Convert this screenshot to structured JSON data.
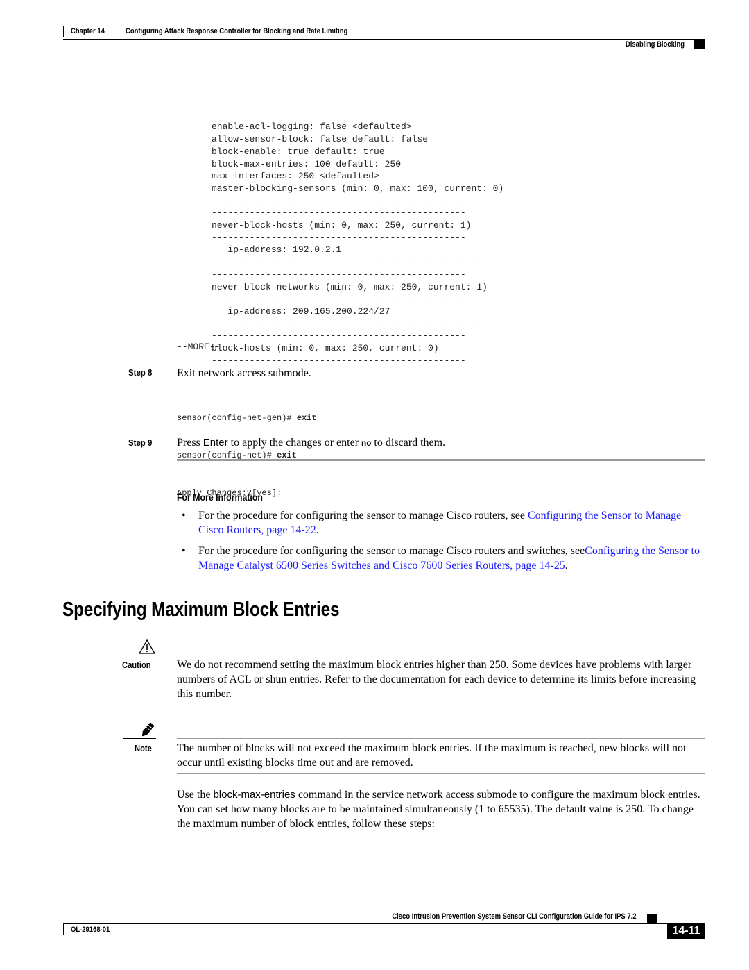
{
  "header": {
    "chapter_label": "Chapter 14",
    "chapter_title": "Configuring Attack Response Controller for Blocking and Rate Limiting",
    "section_title": "Disabling Blocking"
  },
  "code_block": {
    "lines": [
      "enable-acl-logging: false <defaulted>",
      "allow-sensor-block: false default: false",
      "block-enable: true default: true",
      "block-max-entries: 100 default: 250",
      "max-interfaces: 250 <defaulted>",
      "master-blocking-sensors (min: 0, max: 100, current: 0)",
      "-----------------------------------------------",
      "-----------------------------------------------",
      "never-block-hosts (min: 0, max: 250, current: 1)",
      "-----------------------------------------------",
      "   ip-address: 192.0.2.1",
      "   -----------------------------------------------",
      "-----------------------------------------------",
      "never-block-networks (min: 0, max: 250, current: 1)",
      "-----------------------------------------------",
      "   ip-address: 209.165.200.224/27",
      "   -----------------------------------------------",
      "-----------------------------------------------",
      "block-hosts (min: 0, max: 250, current: 0)",
      "-----------------------------------------------"
    ],
    "more_prompt": "--MORE--"
  },
  "steps": [
    {
      "label": "Step 8",
      "text": "Exit network access submode.",
      "code": [
        {
          "prefix": "sensor(config-net-gen)# ",
          "command": "exit"
        },
        {
          "prefix": "sensor(config-net)# ",
          "command": "exit"
        },
        {
          "prefix": "Apply Changes:?[yes]:",
          "command": ""
        }
      ]
    },
    {
      "label": "Step 9",
      "text_before": "Press ",
      "key": "Enter",
      "text_middle": " to apply the changes or enter ",
      "code_word": "no",
      "text_after": " to discard them."
    }
  ],
  "more_info": {
    "heading": "For More Information",
    "bullets": [
      {
        "text": "For the procedure for configuring the sensor to manage Cisco routers, see ",
        "link": "Configuring the Sensor to Manage Cisco Routers, page 14-22",
        "suffix": "."
      },
      {
        "text": "For the procedure for configuring the sensor to manage Cisco routers and switches, see",
        "link": "Configuring the Sensor to Manage Catalyst 6500 Series Switches and Cisco 7600 Series Routers, page 14-25",
        "suffix": "."
      }
    ]
  },
  "section": {
    "title": "Specifying Maximum Block Entries",
    "caution": {
      "label": "Caution",
      "icon": "warning-triangle-icon",
      "text": "We do not recommend setting the maximum block entries higher than 250. Some devices have problems with larger numbers of ACL or shun entries. Refer to the documentation for each device to determine its limits before increasing this number."
    },
    "note": {
      "label": "Note",
      "icon": "pencil-icon",
      "text": "The number of blocks will not exceed the maximum block entries. If the maximum is reached, new blocks will not occur until existing blocks time out and are removed."
    },
    "paragraph": {
      "before": "Use the ",
      "command": "block-max-entries",
      "after": " command in the service network access submode to configure the maximum block entries. You can set how many blocks are to be maintained simultaneously (1 to 65535). The default value is 250. To change the maximum number of block entries, follow these steps:"
    }
  },
  "footer": {
    "guide_title": "Cisco Intrusion Prevention System Sensor CLI Configuration Guide for IPS 7.2",
    "doc_number": "OL-29168-01",
    "page_number": "14-11"
  },
  "colors": {
    "link": "#1a1aff",
    "rule_gray": "#9a9a9a"
  }
}
